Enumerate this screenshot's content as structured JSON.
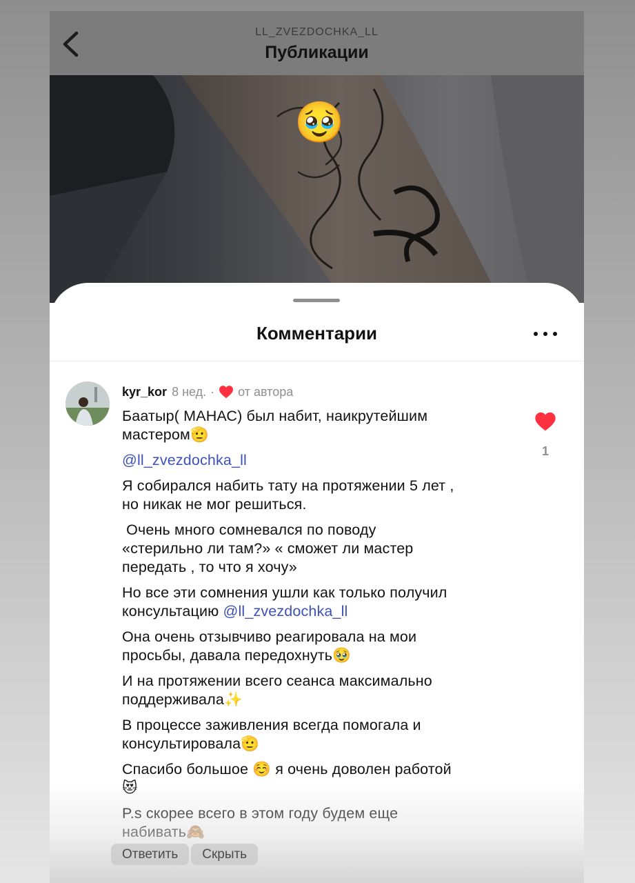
{
  "header": {
    "username": "LL_ZVEZDOCHKA_LL",
    "title": "Публикации"
  },
  "post": {
    "overlay_emoji": "🥹"
  },
  "comments_sheet": {
    "title": "Комментарии"
  },
  "comment": {
    "username": "kyr_kor",
    "time": "8 нед.",
    "separator": "·",
    "author_like_label": "от автора",
    "like_count": "1",
    "paragraphs": [
      {
        "lines": [
          {
            "text": "Баатыр( МАНАС) был набит, наикрутейшим"
          },
          {
            "text": "мастером🫡"
          }
        ]
      },
      {
        "lines": [
          {
            "mention": "@ll_zvezdochka_ll"
          }
        ]
      },
      {
        "lines": [
          {
            "text": "Я собирался набить тату на протяжении 5 лет ,"
          },
          {
            "text": "но никак не мог решиться."
          }
        ]
      },
      {
        "lines": [
          {
            "text": " Очень много сомневался по поводу"
          },
          {
            "text": "«стерильно ли там?» « сможет ли мастер"
          },
          {
            "text": "передать , то что я хочу»"
          }
        ]
      },
      {
        "lines": [
          {
            "text": "Но все эти сомнения ушли как только получил"
          },
          {
            "text": "консультацию ",
            "mention": "@ll_zvezdochka_ll"
          }
        ]
      },
      {
        "lines": [
          {
            "text": "Она очень отзывчиво реагировала на мои"
          },
          {
            "text": "просьбы, давала передохнуть🥹"
          }
        ]
      },
      {
        "lines": [
          {
            "text": "И на протяжении всего сеанса максимально"
          },
          {
            "text": "поддерживала✨"
          }
        ]
      },
      {
        "lines": [
          {
            "text": "В процессе заживления всегда помогала и"
          },
          {
            "text": "консультировала🫡"
          }
        ]
      },
      {
        "lines": [
          {
            "text": "Спасибо большое ☺️ я очень доволен работой"
          },
          {
            "text": "😻"
          }
        ]
      },
      {
        "lines": [
          {
            "text": "P.s скорее всего в этом году будем еще"
          },
          {
            "text": "набивать🙈"
          }
        ]
      }
    ],
    "actions": {
      "reply_label": "Ответить",
      "hide_label": "Скрыть"
    }
  },
  "colors": {
    "like_red": "#ff3040",
    "mention_blue": "#3d52b8",
    "muted_text": "#8e8e8e"
  },
  "icons": {
    "back": "chevron-left-icon",
    "more": "more-horizontal-icon",
    "like": "heart-icon"
  }
}
